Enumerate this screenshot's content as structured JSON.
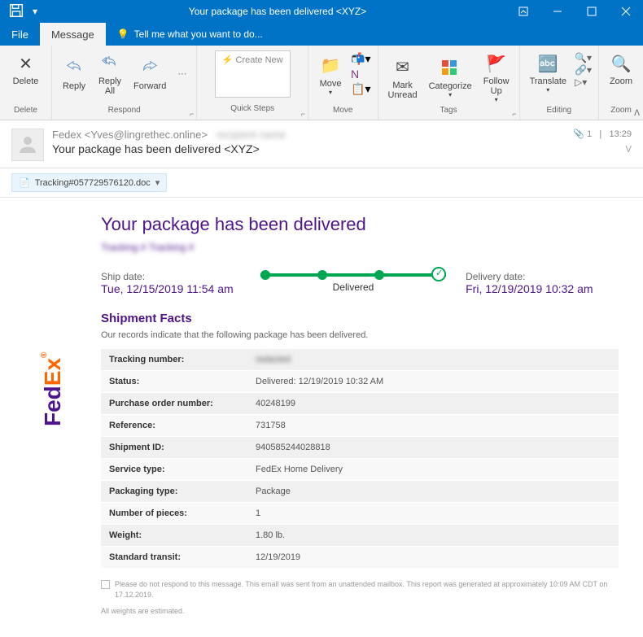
{
  "titlebar": {
    "title": "Your package has been delivered <XYZ>"
  },
  "menubar": {
    "file": "File",
    "message": "Message",
    "tellme": "Tell me what you want to do..."
  },
  "ribbon": {
    "delete_group": "Delete",
    "delete": "Delete",
    "respond_group": "Respond",
    "reply": "Reply",
    "reply_all": "Reply\nAll",
    "forward": "Forward",
    "quicksteps_group": "Quick Steps",
    "create_new": "Create New",
    "move_group": "Move",
    "move": "Move",
    "tags_group": "Tags",
    "mark_unread": "Mark\nUnread",
    "categorize": "Categorize",
    "follow_up": "Follow\nUp",
    "editing_group": "Editing",
    "translate": "Translate",
    "zoom_group": "Zoom",
    "zoom": "Zoom"
  },
  "message": {
    "from": "Fedex <Yves@lingrethec.online>",
    "subject": "Your package has been delivered <XYZ>",
    "attachment_count": "1",
    "time": "13:29",
    "attachment_name": "Tracking#057729576120.doc"
  },
  "email": {
    "heading": "Your package has been delivered",
    "blurred_text": "Tracking # Tracking #",
    "ship_date_label": "Ship date:",
    "ship_date": "Tue, 12/15/2019 11:54 am",
    "delivered_label": "Delivered",
    "delivery_date_label": "Delivery date:",
    "delivery_date": "Fri, 12/19/2019 10:32 am",
    "facts_title": "Shipment Facts",
    "facts_desc": "Our records indicate that the following package has been delivered.",
    "facts": [
      {
        "label": "Tracking number:",
        "value": ""
      },
      {
        "label": "Status:",
        "value": "Delivered: 12/19/2019 10:32 AM"
      },
      {
        "label": "Purchase order number:",
        "value": "40248199"
      },
      {
        "label": "Reference:",
        "value": "731758"
      },
      {
        "label": "Shipment ID:",
        "value": "940585244028818"
      },
      {
        "label": "Service type:",
        "value": "FedEx Home Delivery"
      },
      {
        "label": "Packaging type:",
        "value": "Package"
      },
      {
        "label": "Number of pieces:",
        "value": "1"
      },
      {
        "label": "Weight:",
        "value": "1.80 lb."
      },
      {
        "label": "Standard transit:",
        "value": "12/19/2019"
      }
    ],
    "disclaimer1": "Please do not respond to this message. This email was sent from an unattended mailbox. This report was generated at approximately 10:09 AM CDT on 17.12.2019.",
    "disclaimer2": "All weights are estimated."
  }
}
